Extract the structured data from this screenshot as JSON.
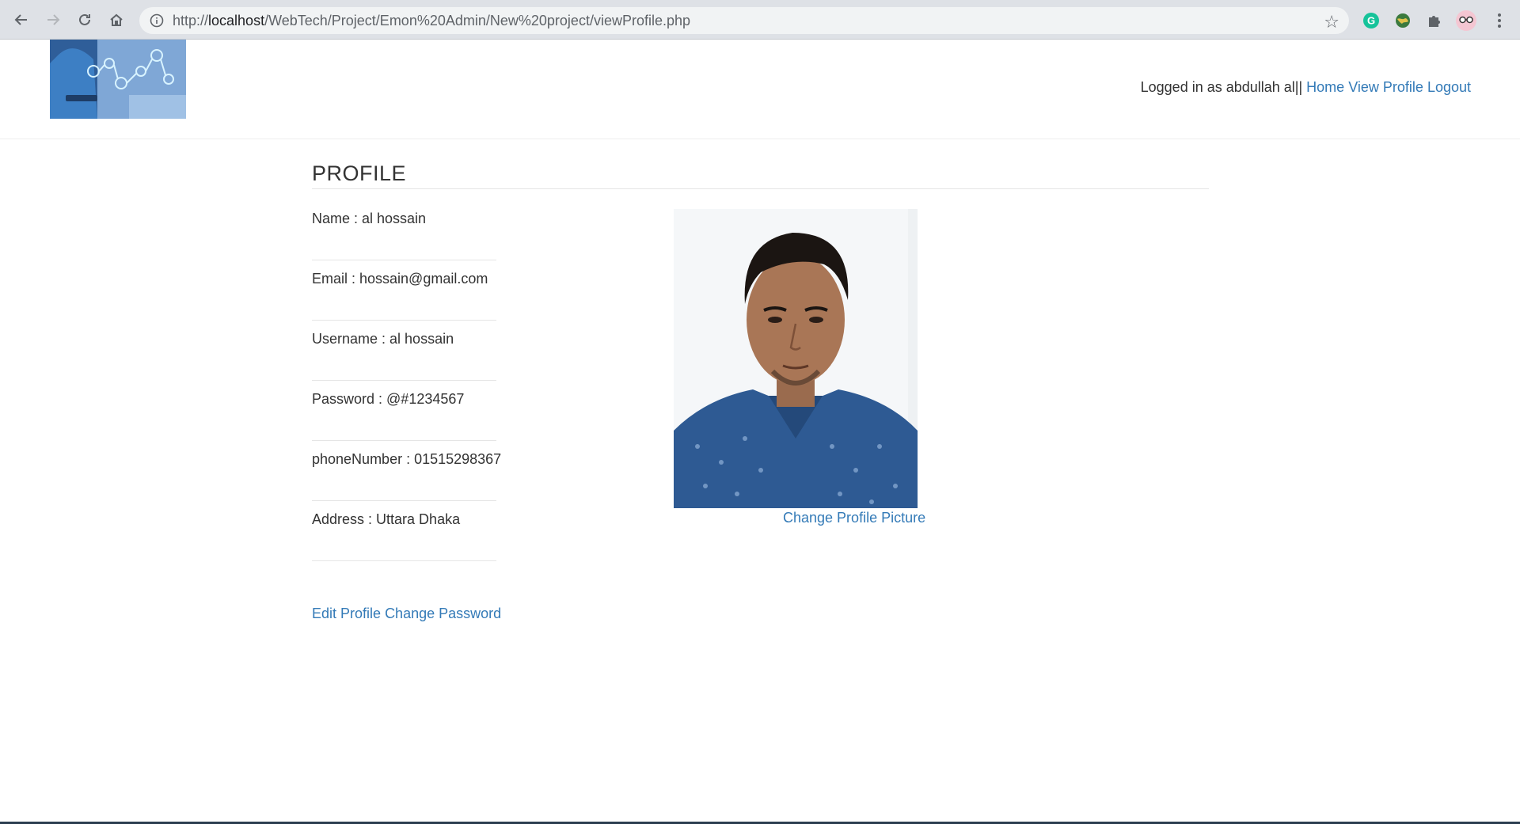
{
  "browser": {
    "url_prefix": "http://",
    "url_host": "localhost",
    "url_path": "/WebTech/Project/Emon%20Admin/New%20project/viewProfile.php",
    "icons": [
      "back-icon",
      "forward-icon",
      "reload-icon",
      "home-icon",
      "site-info-icon",
      "bookmark-star-icon",
      "grammarly-extension-icon",
      "globe-extension-icon",
      "extensions-puzzle-icon",
      "profile-avatar-icon",
      "menu-kebab-icon"
    ]
  },
  "header": {
    "logged_in_label": "Logged in as abdullah al||",
    "links": {
      "home": "Home",
      "view_profile": "View Profile",
      "logout": "Logout"
    }
  },
  "profile": {
    "title": "PROFILE",
    "fields": [
      "Name : al hossain",
      "Email : hossain@gmail.com",
      "Username : al hossain",
      "Password : @#1234567",
      "phoneNumber : 01515298367",
      "Address : Uttara Dhaka"
    ],
    "change_picture_label": "Change Profile Picture",
    "edit_profile_label": "Edit Profile",
    "change_password_label": "Change Password"
  },
  "colors": {
    "link": "#337ab7",
    "text": "#333333",
    "chrome_bg": "#dee1e6"
  }
}
